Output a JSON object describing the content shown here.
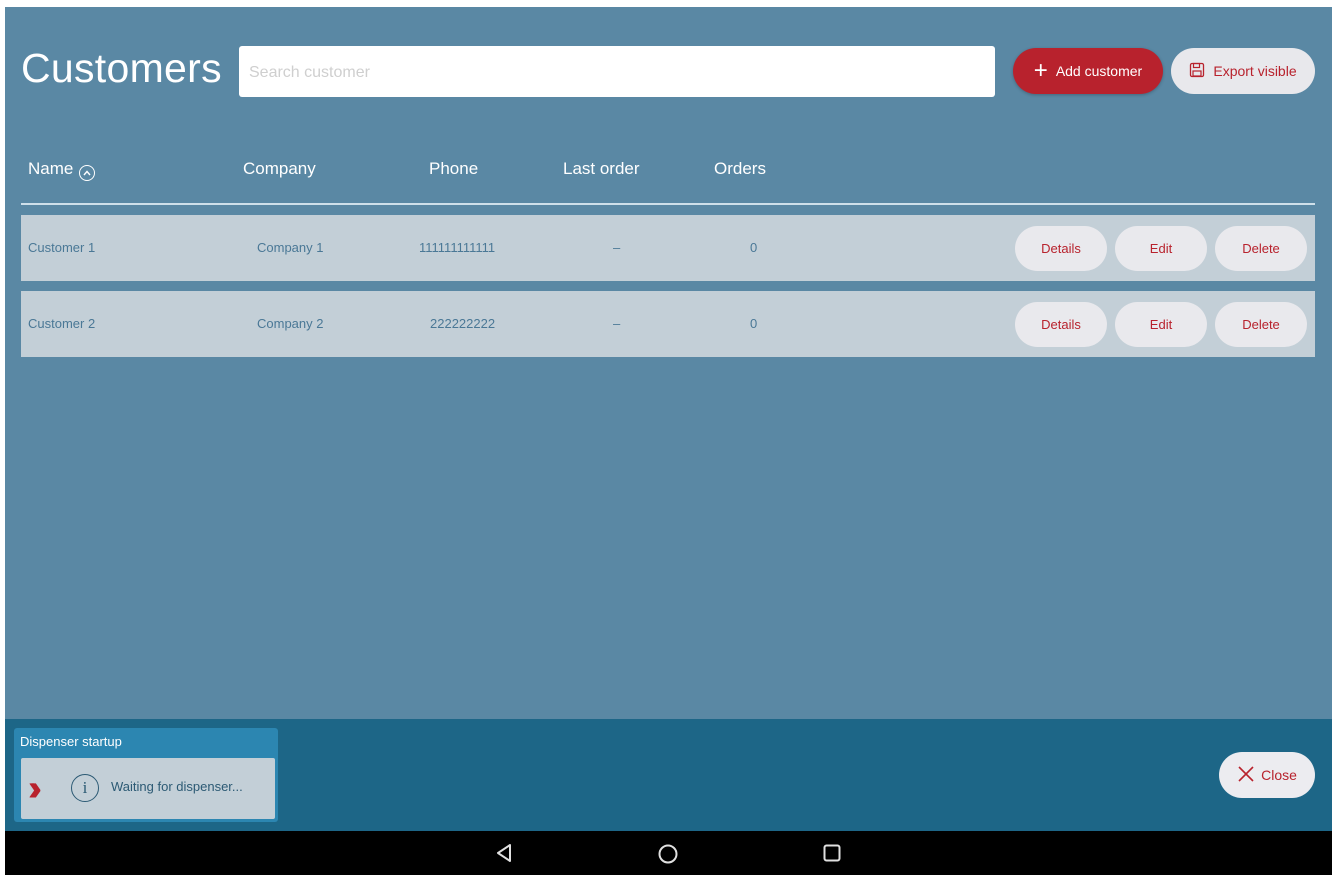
{
  "header": {
    "title": "Customers",
    "search_placeholder": "Search customer",
    "add_label": "Add customer",
    "export_label": "Export visible"
  },
  "table": {
    "columns": [
      "Name",
      "Company",
      "Phone",
      "Last order",
      "Orders"
    ],
    "rows": [
      {
        "name": "Customer 1",
        "company": "Company 1",
        "phone": "111111111111",
        "last_order": "–",
        "orders": "0"
      },
      {
        "name": "Customer 2",
        "company": "Company 2",
        "phone": "222222222",
        "last_order": "–",
        "orders": "0"
      }
    ],
    "actions": {
      "details": "Details",
      "edit": "Edit",
      "delete": "Delete"
    }
  },
  "notification": {
    "title": "Dispenser startup",
    "message": "Waiting for dispenser..."
  },
  "footer": {
    "close_label": "Close"
  },
  "colors": {
    "background": "#5a88a4",
    "accent": "#b8222d",
    "row": "#c3cfd7",
    "bottom_bar": "#1d6687"
  }
}
